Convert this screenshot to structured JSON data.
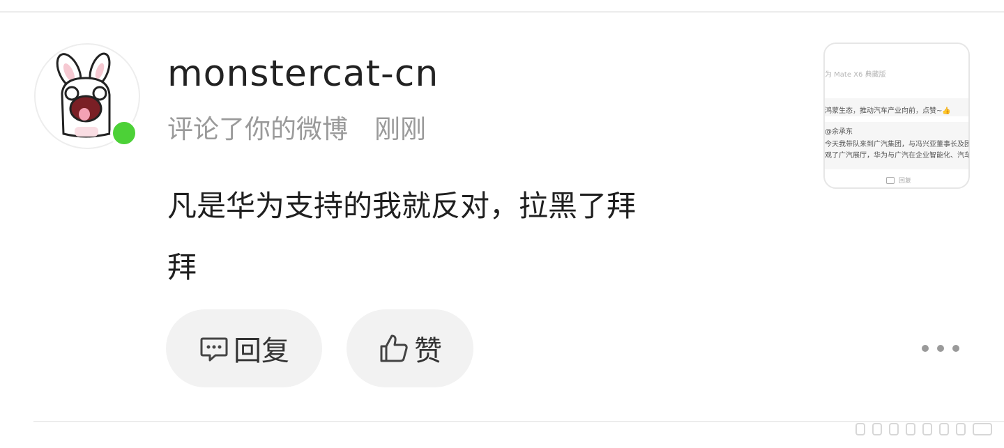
{
  "notification": {
    "username": "monstercat-cn",
    "action": "评论了你的微博",
    "time": "刚刚",
    "comment_line1": "凡是华为支持的我就反对，拉黑了拜",
    "comment_line2": "拜",
    "reply_label": "回复",
    "like_label": "赞"
  },
  "thumbnail": {
    "line1": "为 Mate X6 典藏版",
    "line2": "鸿蒙生态，推动汽车产业向前，点赞~👍",
    "line3": "@余承东",
    "line4": "今天我带队来到广汽集团，与冯兴亚董事长及团队",
    "line5": "观了广汽展厅，华为与广汽在企业智能化、汽车电",
    "reply": "回复"
  },
  "colors": {
    "online": "#4cd137",
    "button_bg": "#f2f2f2",
    "meta_text": "#9a9a9a"
  },
  "icons": {
    "reply": "comment-bubble-icon",
    "like": "thumbs-up-icon",
    "more": "more-dots-icon"
  }
}
